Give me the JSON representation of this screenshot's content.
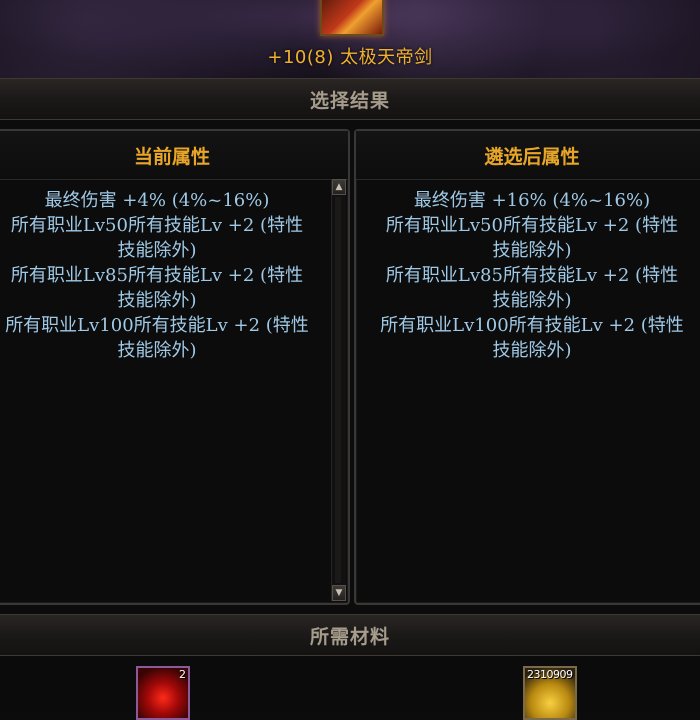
{
  "item": {
    "name": "+10(8) 太极天帝剑"
  },
  "sections": {
    "result": "选择结果",
    "materials": "所需材料"
  },
  "panels": {
    "current": {
      "title": "当前属性",
      "lines": [
        "最终伤害 +4% (4%~16%)",
        "所有职业Lv50所有技能Lv +2 (特性",
        "技能除外)",
        "所有职业Lv85所有技能Lv +2 (特性",
        "技能除外)",
        "所有职业Lv100所有技能Lv +2 (特性",
        "技能除外)"
      ]
    },
    "after": {
      "title": "遴选后属性",
      "lines": [
        "最终伤害 +16% (4%~16%)",
        "所有职业Lv50所有技能Lv +2 (特性",
        "技能除外)",
        "所有职业Lv85所有技能Lv +2 (特性",
        "技能除外)",
        "所有职业Lv100所有技能Lv +2 (特性",
        "技能除外)"
      ]
    }
  },
  "materials": [
    {
      "icon": "red-orb-icon",
      "count": "2"
    },
    {
      "icon": "gold-coins-icon",
      "count": "2310909"
    }
  ],
  "colors": {
    "accent_gold": "#e8a628",
    "stat_blue": "#9fc9e6",
    "title_orange": "#f0b030"
  }
}
